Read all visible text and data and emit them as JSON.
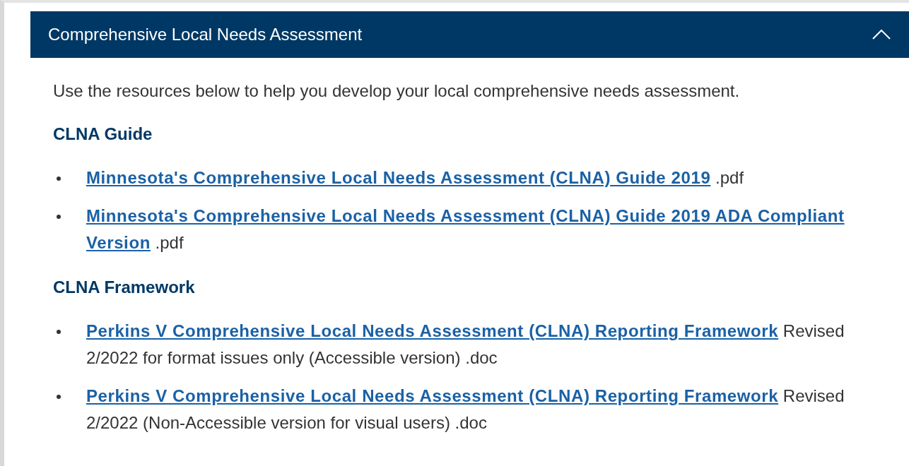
{
  "panel": {
    "title": "Comprehensive Local Needs Assessment",
    "expanded": true
  },
  "intro": "Use the resources below to help you develop your local comprehensive needs assessment.",
  "sections": [
    {
      "heading": "CLNA Guide",
      "items": [
        {
          "link": [
            "Minnesota's Comprehensive Local Needs Assessment (CLNA) Guide 2019"
          ],
          "note": ".pdf"
        },
        {
          "link": [
            "Minnesota's Comprehensive Local Needs Assessment (CLNA) Guide 2019 ADA Compliant",
            "Version"
          ],
          "note": ".pdf"
        }
      ]
    },
    {
      "heading": "CLNA Framework",
      "items": [
        {
          "link": [
            "Perkins V Comprehensive Local Needs Assessment (CLNA) Reporting Framework"
          ],
          "note": "Revised 2/2022 for format issues only (Accessible version) .doc"
        },
        {
          "link": [
            "Perkins V Comprehensive Local Needs Assessment (CLNA) Reporting Framework"
          ],
          "note": "Revised 2/2022 (Non-Accessible version for visual users) .doc"
        }
      ]
    }
  ]
}
